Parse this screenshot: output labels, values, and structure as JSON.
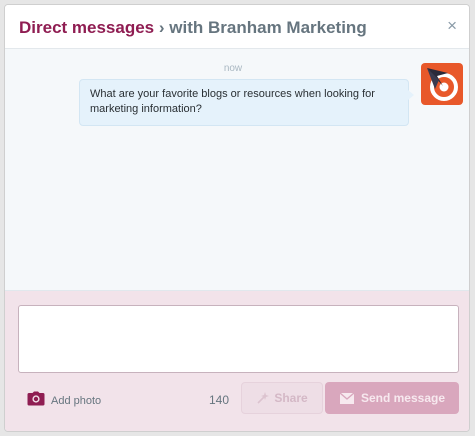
{
  "header": {
    "title_main": "Direct messages",
    "title_separator": "›",
    "title_sub": "with Branham Marketing",
    "close_glyph": "×"
  },
  "conversation": {
    "timestamp": "now",
    "messages": [
      {
        "text": "What are your favorite blogs or resources when looking for marketing information?",
        "avatar": "branham-marketing-logo"
      }
    ]
  },
  "compose": {
    "placeholder": "",
    "add_photo_label": "Add photo",
    "char_count": "140",
    "share_label": "Share",
    "send_label": "Send message"
  },
  "colors": {
    "accent": "#8f1d52",
    "compose_bg": "#f2e3ea",
    "send_button": "#d9a7bd",
    "conversation_bg": "#f5f8fa",
    "bubble_bg": "#e5f2fb",
    "avatar_bg": "#e8582a"
  },
  "icons": {
    "close": "close-icon",
    "camera": "camera-icon",
    "share": "share-icon",
    "send": "envelope-icon"
  }
}
